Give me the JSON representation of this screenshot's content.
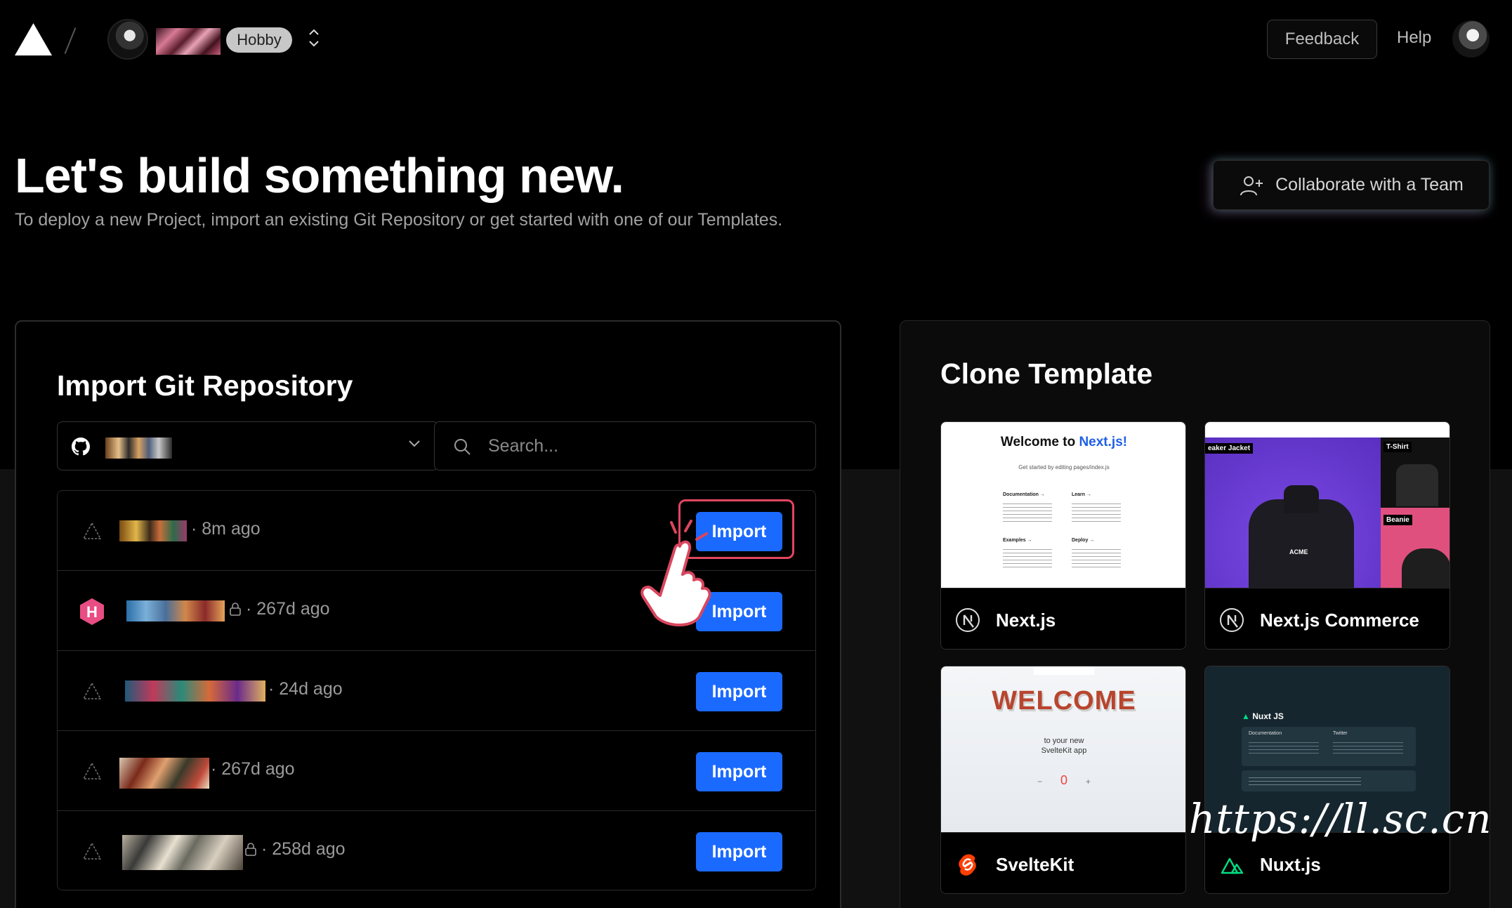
{
  "header": {
    "team_badge": "Hobby",
    "feedback_label": "Feedback",
    "help_label": "Help"
  },
  "hero": {
    "title": "Let's build something new.",
    "subtitle": "To deploy a new Project, import an existing Git Repository or get started with one of our Templates.",
    "collaborate_label": "Collaborate with a Team"
  },
  "import_panel": {
    "title": "Import Git Repository",
    "search_placeholder": "Search...",
    "import_label": "Import",
    "repos": [
      {
        "icon": "vercel-outline-icon",
        "meta": "· 8m ago",
        "private": false
      },
      {
        "icon": "hexo-icon",
        "meta": "· 267d ago",
        "private": true
      },
      {
        "icon": "vercel-outline-icon",
        "meta": "· 24d ago",
        "private": false
      },
      {
        "icon": "vercel-outline-icon",
        "meta": "· 267d ago",
        "private": false
      },
      {
        "icon": "vercel-outline-icon",
        "meta": "· 258d ago",
        "private": true
      }
    ]
  },
  "clone_panel": {
    "title": "Clone Template",
    "templates": [
      {
        "name": "Next.js",
        "icon": "nextjs-icon"
      },
      {
        "name": "Next.js Commerce",
        "icon": "nextjs-icon"
      },
      {
        "name": "SvelteKit",
        "icon": "svelte-icon"
      },
      {
        "name": "Nuxt.js",
        "icon": "nuxt-icon"
      }
    ],
    "nextjs_preview": {
      "heading_prefix": "Welcome to ",
      "heading_accent": "Next.js!",
      "sub": "Get started by editing pages/index.js",
      "cards": [
        "Documentation →",
        "Learn →",
        "Examples →",
        "Deploy →"
      ]
    },
    "commerce_preview": {
      "jacket": "eaker Jacket",
      "tshirt": "T-Shirt",
      "beanie": "Beanie",
      "brand": "ACME"
    },
    "svelte_preview": {
      "welcome": "WELCOME",
      "line1": "to your new",
      "line2": "SvelteKit app",
      "counter": "0"
    },
    "nuxt_preview": {
      "brand": "Nuxt JS",
      "doc": "Documentation",
      "twitter": "Twitter"
    }
  },
  "watermark": "https://ll.sc.cn",
  "colors": {
    "accent_blue": "#1a6aff",
    "highlight_red": "#e2465f",
    "hexo_pink": "#e84d83"
  }
}
